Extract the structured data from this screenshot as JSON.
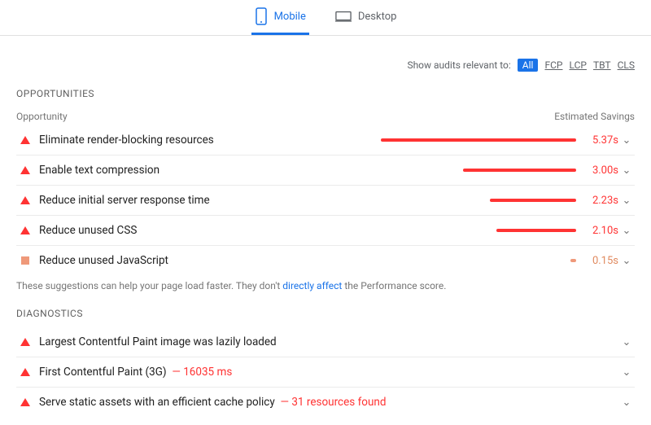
{
  "tabs": {
    "mobile": "Mobile",
    "desktop": "Desktop"
  },
  "filterLabel": "Show audits relevant to:",
  "filters": {
    "all": "All",
    "fcp": "FCP",
    "lcp": "LCP",
    "tbt": "TBT",
    "cls": "CLS"
  },
  "opportunities": {
    "title": "OPPORTUNITIES",
    "colOpportunity": "Opportunity",
    "colSavings": "Estimated Savings",
    "items": [
      {
        "label": "Eliminate render-blocking resources",
        "savings": "5.37s",
        "severity": "fail",
        "barPct": 100
      },
      {
        "label": "Enable text compression",
        "savings": "3.00s",
        "severity": "fail",
        "barPct": 58
      },
      {
        "label": "Reduce initial server response time",
        "savings": "2.23s",
        "severity": "fail",
        "barPct": 44
      },
      {
        "label": "Reduce unused CSS",
        "savings": "2.10s",
        "severity": "fail",
        "barPct": 41
      },
      {
        "label": "Reduce unused JavaScript",
        "savings": "0.15s",
        "severity": "avg",
        "barPct": 3
      }
    ],
    "note_pre": "These suggestions can help your page load faster. They don't ",
    "note_link": "directly affect",
    "note_post": " the Performance score."
  },
  "diagnostics": {
    "title": "DIAGNOSTICS",
    "items": [
      {
        "label": "Largest Contentful Paint image was lazily loaded",
        "metric": "",
        "severity": "fail"
      },
      {
        "label": "First Contentful Paint (3G)",
        "metric": "— 16035 ms",
        "severity": "fail"
      },
      {
        "label": "Serve static assets with an efficient cache policy",
        "metric": "— 31 resources found",
        "severity": "fail"
      }
    ]
  }
}
